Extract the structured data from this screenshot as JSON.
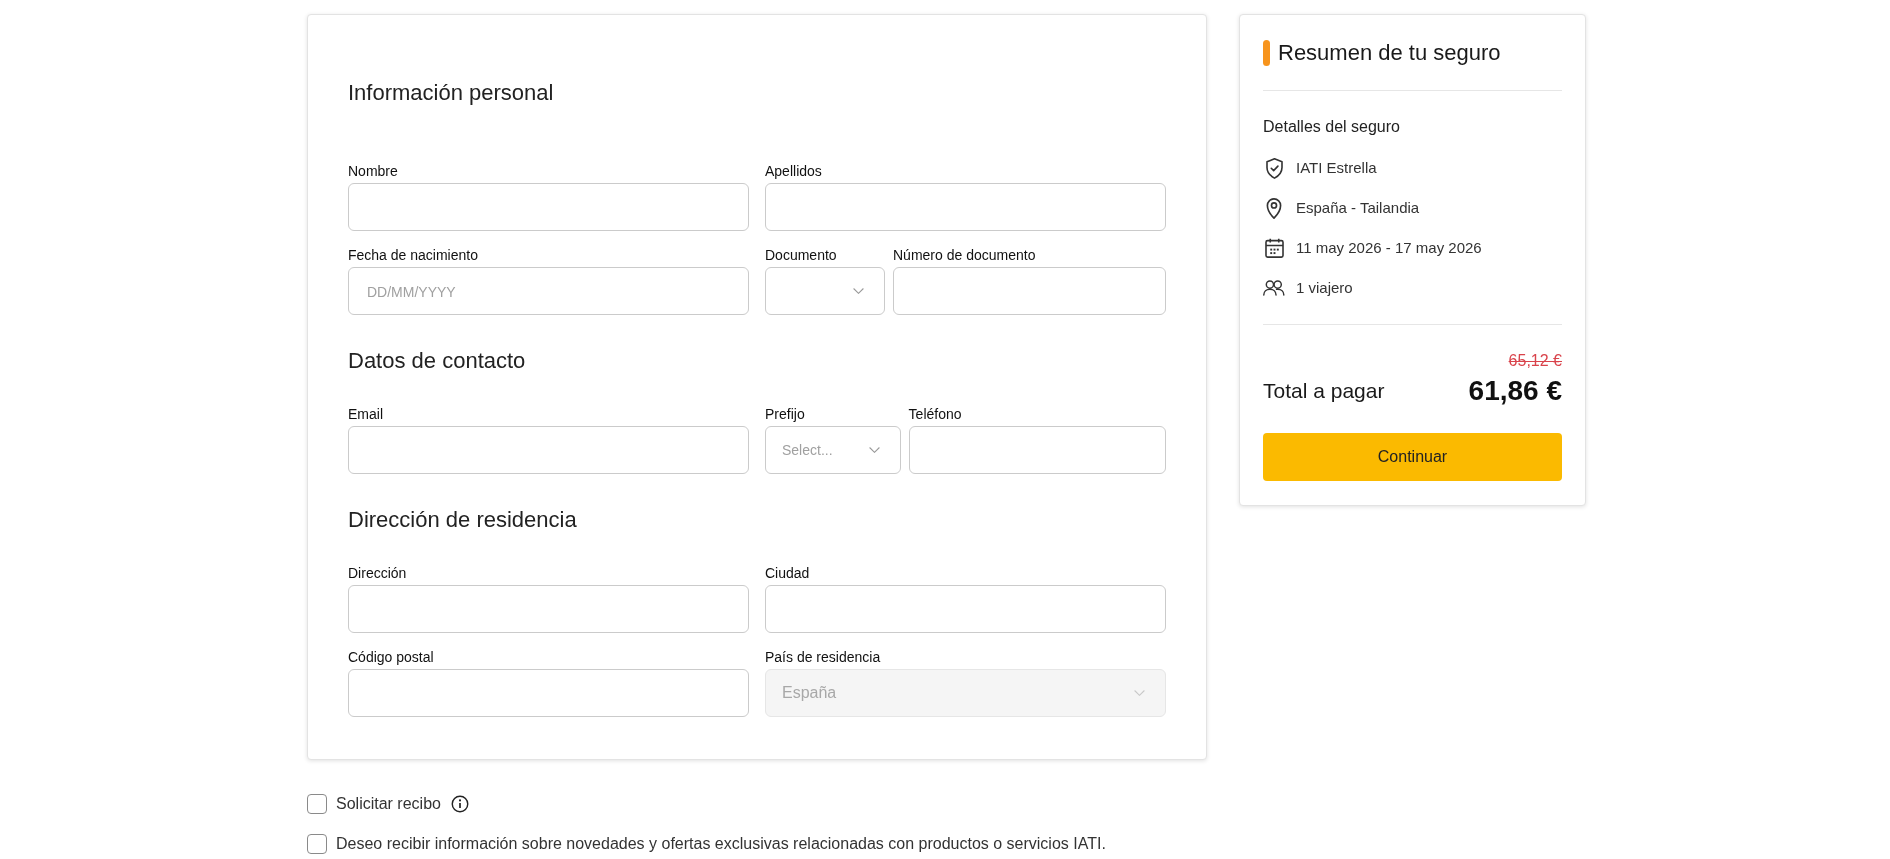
{
  "form": {
    "sections": [
      {
        "title": "Información personal",
        "rows": [
          {
            "fields": [
              {
                "kind": "text",
                "label": "Nombre",
                "disabled": false
              },
              {
                "kind": "text",
                "label": "Apellidos",
                "disabled": false
              }
            ]
          },
          {
            "fields": [
              {
                "kind": "text",
                "label": "Fecha de nacimiento",
                "placeholder": "DD/MM/YYYY",
                "disabled": false
              },
              {
                "kind": "select",
                "label": "Documento",
                "disabled": false
              },
              {
                "kind": "text",
                "label": "Número de documento",
                "disabled": false
              }
            ]
          }
        ]
      },
      {
        "title": "Datos de contacto",
        "rows": [
          {
            "fields": [
              {
                "kind": "text",
                "label": "Email",
                "disabled": false
              },
              {
                "kind": "select",
                "label": "Prefijo",
                "placeholder": "Select...",
                "disabled": false
              },
              {
                "kind": "text",
                "label": "Teléfono",
                "disabled": false
              }
            ]
          }
        ]
      },
      {
        "title": "Dirección de residencia",
        "rows": [
          {
            "fields": [
              {
                "kind": "text",
                "label": "Dirección",
                "disabled": false
              },
              {
                "kind": "text",
                "label": "Ciudad",
                "disabled": false
              }
            ]
          },
          {
            "fields": [
              {
                "kind": "text",
                "label": "Código postal",
                "disabled": false
              },
              {
                "kind": "select",
                "label": "País de residencia",
                "value": "España",
                "disabled": true
              }
            ]
          }
        ]
      }
    ]
  },
  "summary": {
    "title": "Resumen de tu seguro",
    "details_title": "Detalles del seguro",
    "details": [
      {
        "kind": "product",
        "text": "IATI Estrella"
      },
      {
        "kind": "route",
        "text": "España - Tailandia"
      },
      {
        "kind": "dates",
        "text": "11 may 2026 - 17 may 2026"
      },
      {
        "kind": "travelers",
        "text": "1 viajero"
      }
    ],
    "total": {
      "label": "Total a pagar",
      "original_price": "65,12 €",
      "price": "61,86 €"
    },
    "button": "Continuar"
  },
  "consents": [
    {
      "label": "Solicitar recibo",
      "checked": false,
      "info": true
    },
    {
      "label": "Deseo recibir información sobre novedades y ofertas exclusivas relacionadas con productos o servicios IATI.",
      "checked": false
    }
  ]
}
